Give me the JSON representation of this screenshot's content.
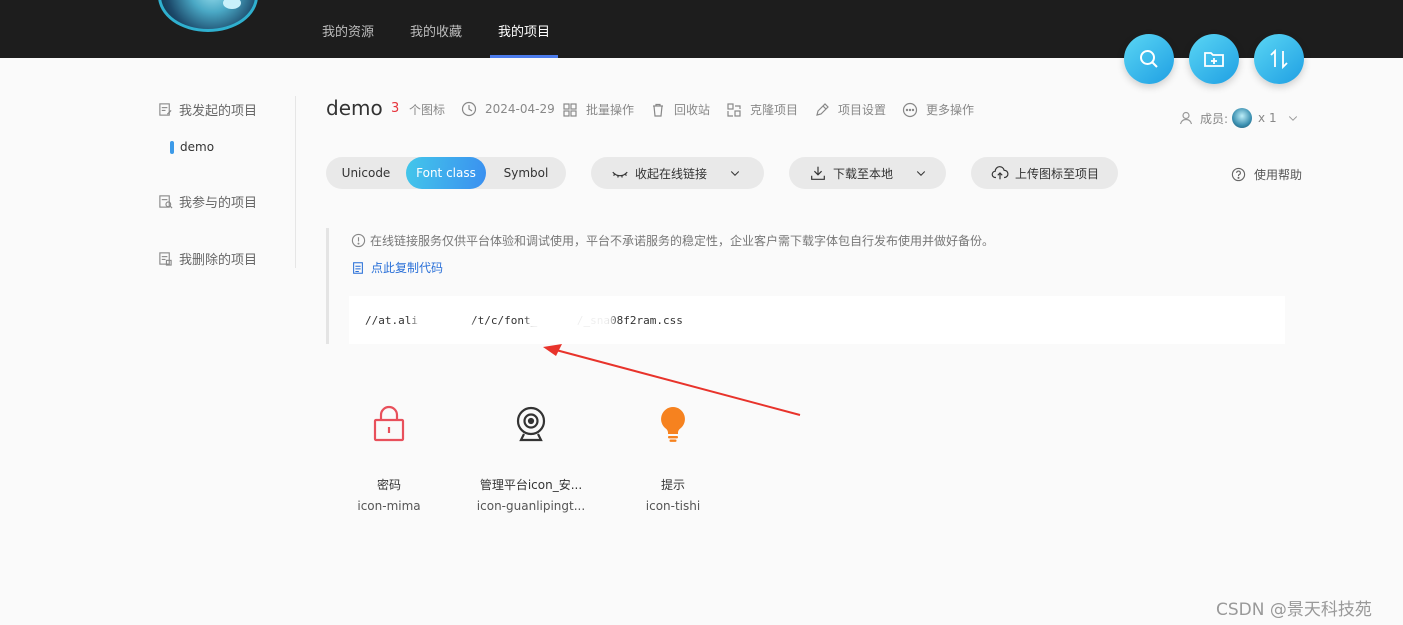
{
  "topnav": {
    "items": [
      {
        "label": "我的资源",
        "active": false
      },
      {
        "label": "我的收藏",
        "active": false
      },
      {
        "label": "我的项目",
        "active": true
      }
    ]
  },
  "fab": {
    "search_icon": "search-icon",
    "add_folder_icon": "folder-add-icon",
    "sort_icon": "sort-icon",
    "color": "#1f9fe3"
  },
  "sidebar": {
    "created": "我发起的项目",
    "created_child": "demo",
    "joined": "我参与的项目",
    "deleted": "我删除的项目"
  },
  "project": {
    "name": "demo",
    "icon_count": "3",
    "icon_count_label": "个图标",
    "date": "2024-04-29",
    "batch": "批量操作",
    "recycle": "回收站",
    "clone": "克隆项目",
    "settings": "项目设置",
    "more": "更多操作"
  },
  "members": {
    "label": "成员:",
    "count": "x 1"
  },
  "tabs": {
    "unicode": "Unicode",
    "font_class": "Font class",
    "symbol": "Symbol",
    "active": "Font class"
  },
  "actions": {
    "collapse_link": "收起在线链接",
    "download": "下载至本地",
    "upload": "上传图标至项目",
    "help": "使用帮助"
  },
  "notice": {
    "text": "在线链接服务仅供平台体验和调试使用，平台不承诺服务的稳定性，企业客户需下载字体包自行发布使用并做好备份。",
    "copy": "点此复制代码",
    "code": "//at.ali        /t/c/font_      /_sna08f2ram.css"
  },
  "icons": [
    {
      "name": "密码",
      "code": "icon-mima",
      "color": "#e8505b"
    },
    {
      "name": "管理平台icon_安...",
      "code": "icon-guanlipingt...",
      "color": "#333333"
    },
    {
      "name": "提示",
      "code": "icon-tishi",
      "color": "#f6821f"
    }
  ],
  "watermark": "CSDN @景天科技苑",
  "accent_color": "#3a8ff0"
}
